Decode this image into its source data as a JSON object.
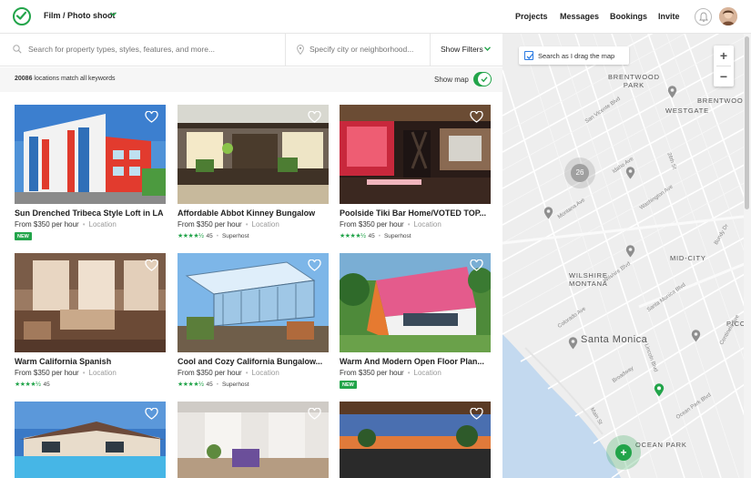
{
  "header": {
    "activity": "Film / Photo shoot",
    "nav": [
      "Projects",
      "Messages",
      "Bookings",
      "Invite"
    ]
  },
  "search": {
    "keywords_placeholder": "Search for property types, styles, features, and more...",
    "city_placeholder": "Specify city or neighborhood...",
    "filters_label": "Show Filters"
  },
  "results": {
    "count": "20086",
    "count_suffix": " locations match all keywords",
    "show_map_label": "Show map",
    "show_map_on": true
  },
  "listings": [
    {
      "title": "Sun Drenched Tribeca Style Loft in LA",
      "price": "From $350 per hour",
      "location": "Location",
      "badge": "NEW"
    },
    {
      "title": "Affordable Abbot Kinney Bungalow",
      "price": "From $350 per hour",
      "location": "Location",
      "rating": 4.5,
      "rating_count": "45",
      "host": "Superhost"
    },
    {
      "title": "Poolside Tiki Bar Home/VOTED TOP...",
      "price": "From $350 per hour",
      "location": "Location",
      "rating": 4.5,
      "rating_count": "45",
      "host": "Superhost"
    },
    {
      "title": "Warm California Spanish",
      "price": "From $350 per hour",
      "location": "Location",
      "rating": 4.5,
      "rating_count": "45"
    },
    {
      "title": "Cool and Cozy California Bungalow...",
      "price": "From $350 per hour",
      "location": "Location",
      "rating": 4.5,
      "rating_count": "45",
      "host": "Superhost"
    },
    {
      "title": "Warm And Modern Open Floor Plan...",
      "price": "From $350 per hour",
      "location": "Location",
      "badge": "NEW"
    },
    {
      "title": "",
      "price": "",
      "location": ""
    },
    {
      "title": "",
      "price": "",
      "location": ""
    },
    {
      "title": "",
      "price": "",
      "location": ""
    }
  ],
  "map": {
    "drag_label": "Search as I drag the map",
    "drag_checked": true,
    "zoom_in": "+",
    "zoom_out": "−",
    "cluster_count": "26",
    "labels": {
      "brentwood_park": "BRENTWOOD\nPARK",
      "brentwood": "BRENTWOOD",
      "westgate": "WESTGATE",
      "mid_city": "MID-CITY",
      "wilshire_montana": "WILSHIRE\nMONTANA",
      "pico": "PICO",
      "santa_monica": "Santa Monica",
      "ocean_park": "OCEAN PARK"
    },
    "streets": [
      "Santa Monica Blvd",
      "Wilshire Blvd",
      "Montana Ave",
      "Idaho Ave",
      "Washington Ave",
      "San Vicente Blvd",
      "Broadway",
      "Ocean Park Blvd",
      "26th St",
      "Lincoln Blvd",
      "Bundy Dr",
      "Centinela Ave",
      "Main St",
      "Colorado Ave"
    ]
  },
  "colors": {
    "brand": "#22a44a",
    "link": "#2a7ae2",
    "map_water": "#c3d9ef"
  },
  "icons": [
    "check-logo-icon",
    "chevron-down-icon",
    "bell-icon",
    "avatar",
    "search-icon",
    "pin-icon",
    "heart-icon",
    "star-icon",
    "plus-icon",
    "map-pin-icon"
  ]
}
